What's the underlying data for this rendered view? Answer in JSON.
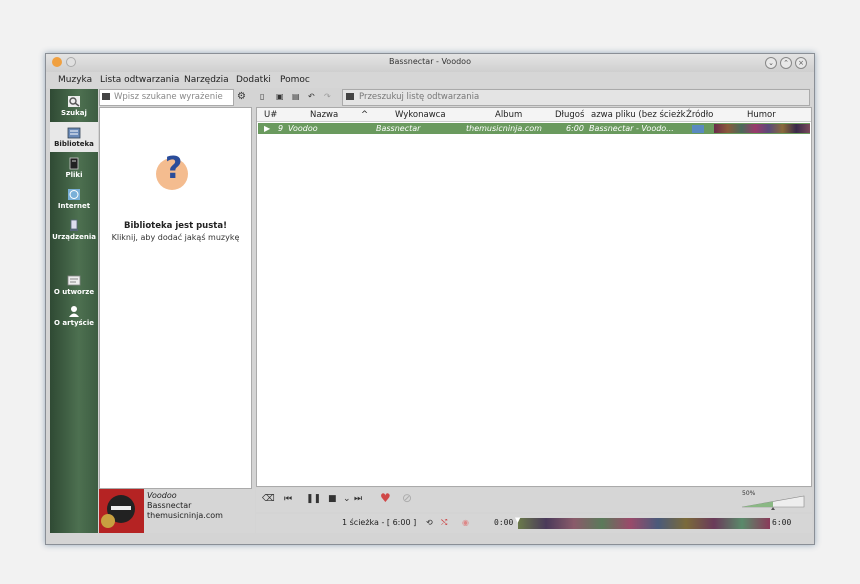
{
  "window": {
    "title": "Bassnectar - Voodoo"
  },
  "menu": [
    "Muzyka",
    "Lista odtwarzania",
    "Narzędzia",
    "Dodatki",
    "Pomoc"
  ],
  "sidebar": {
    "items": [
      {
        "label": "Szukaj",
        "icon": "search-icon"
      },
      {
        "label": "Biblioteka",
        "icon": "library-icon"
      },
      {
        "label": "Pliki",
        "icon": "files-icon"
      },
      {
        "label": "Internet",
        "icon": "internet-icon"
      },
      {
        "label": "Urządzenia",
        "icon": "devices-icon"
      },
      {
        "label": "O utworze",
        "icon": "song-info-icon"
      },
      {
        "label": "O artyście",
        "icon": "artist-info-icon"
      }
    ]
  },
  "library": {
    "search_placeholder": "Wpisz szukane wyrażenie",
    "empty_title": "Biblioteka jest pusta!",
    "empty_subtitle": "Kliknij, aby dodać jakąś muzykę"
  },
  "now_playing": {
    "title": "Voodoo",
    "artist": "Bassnectar",
    "album": "themusicninja.com"
  },
  "playlist": {
    "search_placeholder": "Przeszukuj listę odtwarzania",
    "columns": [
      "U#",
      "Nazwa",
      "Wykonawca",
      "Album",
      "Długość",
      "Nazwa pliku (bez ścieżki)",
      "Źródło",
      "Humor"
    ],
    "columns_visible": [
      "U#",
      "Nazwa",
      "^",
      "Wykonawca",
      "Album",
      "Długoś",
      "azwa pliku (bez ścieżk",
      "Źródło",
      "Humor"
    ],
    "rows": [
      {
        "track": "9",
        "title": "Voodoo",
        "artist": "Bassnectar",
        "album": "themusicninja.com",
        "length": "6:00",
        "filename": "Bassnectar - Voodo..."
      }
    ]
  },
  "controls": {
    "volume_label": "50%",
    "volume_level": 0.5
  },
  "status": {
    "summary": "1 ścieżka - [ 6:00 ]",
    "position": "0:00",
    "duration": "6:00",
    "progress": 0.0
  },
  "colors": {
    "sidebar": "#3f6044",
    "selected_row": "#6a9a5e",
    "love": "#d04848"
  }
}
